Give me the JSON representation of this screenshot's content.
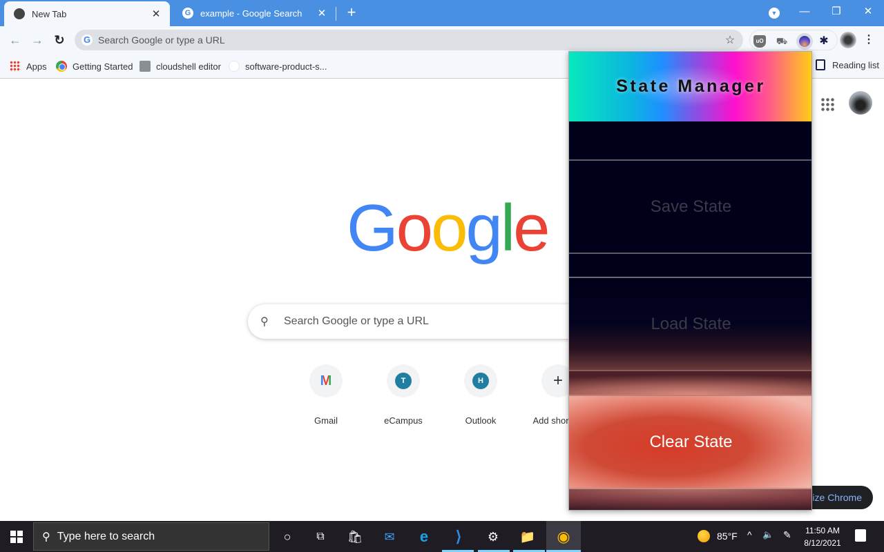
{
  "browser": {
    "tabs": [
      {
        "title": "New Tab",
        "favicon": "chrome-icon",
        "active": true
      },
      {
        "title": "example - Google Search",
        "favicon": "google-g-icon",
        "active": false
      }
    ],
    "close_glyph": "✕",
    "new_tab_glyph": "+",
    "window_controls": {
      "minimize": "—",
      "restore": "❐",
      "close": "✕"
    },
    "omnibox": {
      "placeholder": "Search Google or type a URL",
      "g_glyph": "G",
      "star_glyph": "☆"
    },
    "nav": {
      "back": "←",
      "forward": "→",
      "reload": "↻"
    },
    "extensions": {
      "ublock_label": "uO",
      "fox_glyph": "🦊",
      "puzzle_glyph": "✱",
      "menu_glyph": "⋮"
    },
    "bookmarks": [
      {
        "label": "Apps",
        "icon": "apps-grid-icon"
      },
      {
        "label": "Getting Started",
        "icon": "chrome-icon"
      },
      {
        "label": "cloudshell editor",
        "icon": "cloudshell-icon"
      },
      {
        "label": "software-product-s...",
        "icon": "github-icon"
      }
    ],
    "reading_list": "Reading list"
  },
  "newtab": {
    "logo": [
      {
        "ch": "G",
        "color": "#4285f4"
      },
      {
        "ch": "o",
        "color": "#ea4335"
      },
      {
        "ch": "o",
        "color": "#fbbc05"
      },
      {
        "ch": "g",
        "color": "#4285f4"
      },
      {
        "ch": "l",
        "color": "#34a853"
      },
      {
        "ch": "e",
        "color": "#ea4335"
      }
    ],
    "search_placeholder": "Search Google or type a URL",
    "search_glyph": "🔍",
    "shortcuts": [
      {
        "label": "Gmail",
        "glyph": "M"
      },
      {
        "label": "eCampus",
        "glyph": "T"
      },
      {
        "label": "Outlook",
        "glyph": "H"
      },
      {
        "label": "Add shortcut",
        "glyph": "+"
      }
    ],
    "customize": "Customize Chrome"
  },
  "popup": {
    "title": "State Manager",
    "buttons": {
      "save": "Save State",
      "load": "Load State",
      "clear": "Clear State"
    }
  },
  "taskbar": {
    "search_placeholder": "Type here to search",
    "search_glyph": "⚲",
    "cortana_glyph": "○",
    "taskview_glyph": "⧉",
    "store_glyph": "🛍",
    "mail_glyph": "✉",
    "edge_glyph": "e",
    "vscode_glyph": "⟩",
    "settings_glyph": "⚙",
    "explorer_glyph": "📁",
    "chrome_glyph": "◉",
    "weather": "85°F",
    "tray_chevron": "^",
    "volume_glyph": "🔈",
    "pen_glyph": "✎",
    "time": "11:50 AM",
    "date": "8/12/2021"
  }
}
